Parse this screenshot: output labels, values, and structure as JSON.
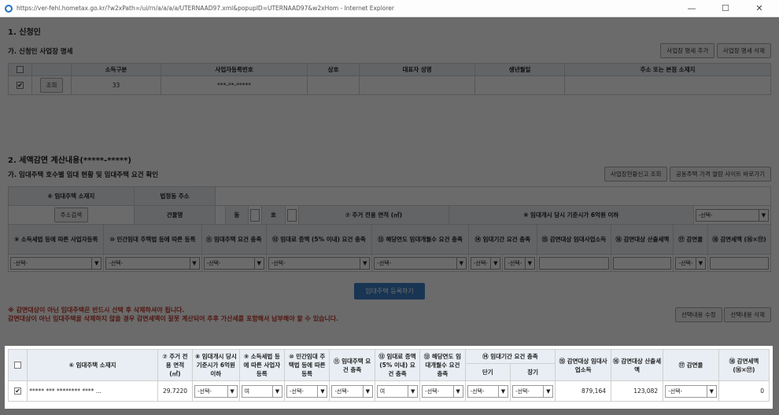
{
  "window": {
    "title": "https://ver-fehl.hometax.go.kr/?w2xPath=/ui/rn/a/a/a/a/UTERNAAD97.xml&popupID=UTERNAAD97&w2xHom - Internet Explorer",
    "min": "—",
    "max": "☐",
    "close": "✕"
  },
  "sec1": {
    "title": "1. 신청인",
    "subtitle": "가. 신청인 사업장 명세",
    "add_btn": "사업장 명세 추가",
    "del_btn": "사업장 명세 삭제",
    "headers": [
      "소득구분",
      "사업자등록번호",
      "상호",
      "대표자 성명",
      "생년월일",
      "주소 또는 본점 소재지"
    ],
    "row": {
      "btn": "조회",
      "code": "33",
      "bizno": "***-**-*****"
    }
  },
  "sec2": {
    "title": "2. 세액감면 계산내용(*****-*****)",
    "subtitle": "가. 임대주택 호수별 임대 현황 및 임대주택 요건 확인",
    "btn_report": "사업장현황신고 조회",
    "btn_price": "공동주택 가격 열람 사이트 바로가기",
    "r1": [
      "⑥ 임대주택 소재지",
      "법정동 주소"
    ],
    "r2": [
      "주소검색",
      "건물명",
      "동",
      "호",
      "⑦ 주거 전용 면적 (㎡)",
      "⑧ 임대개시 당시 기준시가 6억원 이하",
      "-선택-"
    ],
    "r3": [
      "⑨ 소득세법 등에 따른 사업자등록",
      "⑩ 민간임대 주택법 등에 따른 등록",
      "⑪ 임대주택 요건 충족",
      "⑫ 임대료 증액 (5% 이내) 요건 충족",
      "⑬ 해당연도 임대개월수 요건 충족",
      "⑭ 임대기간 요건 충족",
      "⑮ 감면대상 임대사업소득",
      "⑯ 감면대상 산출세액",
      "⑰ 감면율",
      "⑱ 감면세액 (⑯×⑰)"
    ],
    "r3_sub": [
      "단기",
      "장기"
    ],
    "select": "-선택-",
    "register_btn": "임대주택 등록하기",
    "warn1": "※ 감면대상이 아닌 임대주택은 반드시 선택 후 삭제하셔야 됩니다.",
    "warn2": "감면대상이 아닌 임대주택을 삭제하지 않을 경우 감면세액이 잘못 계산되어 추후 가산세를 포함해서 납부해야 할 수 있습니다.",
    "edit_btn": "선택내용 수정",
    "delete_btn": "선택내용 삭제"
  },
  "grid": {
    "headers": [
      "⑥ 임대주택 소재지",
      "⑦ 주거 전용 면적 (㎡)",
      "⑧ 임대개시 당시 기준시가 6억원 이하",
      "⑨ 소득세법 등에 따른 사업자등록",
      "⑩ 민간임대 주택법 등에 따른 등록",
      "⑪ 임대주택 요건 충족",
      "⑫ 임대료 증액 (5% 이내) 요건 충족",
      "⑬ 해당연도 임대개월수 요건 충족",
      "⑭ 임대기간 요건 충족",
      "⑮ 감면대상 임대사업소득",
      "⑯ 감면대상 산출세액",
      "⑰ 감면율",
      "⑱ 감면세액 (⑯×⑰)"
    ],
    "sub": [
      "단기",
      "장기"
    ],
    "row": {
      "address": "***** *** ******** **** ...",
      "area": "29.7220",
      "v8": "-선택-",
      "v9": "여",
      "v10": "-선택-",
      "v11": "-선택-",
      "v12": "여",
      "v13": "-선택-",
      "short": "-선택-",
      "long": "-선택-",
      "income": "879,164",
      "tax": "123,082",
      "rate": "-선택-",
      "reduce": "0"
    }
  }
}
